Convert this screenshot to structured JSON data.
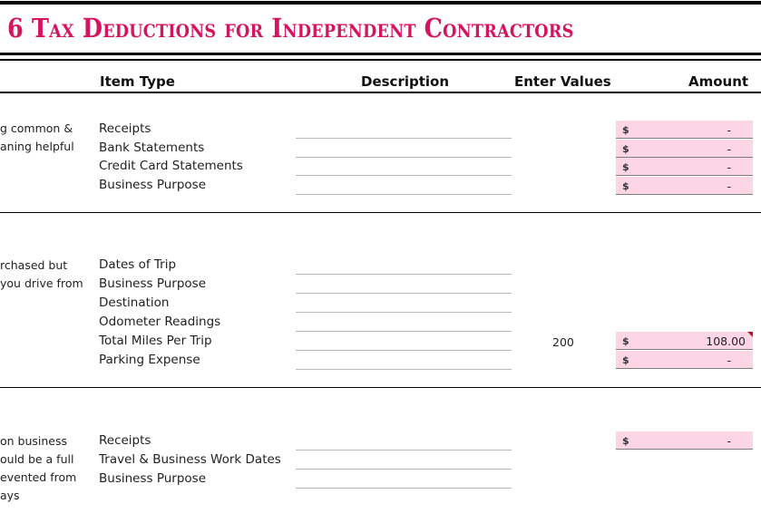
{
  "title": "6 Tax Deductions for Independent Contractors",
  "columns": {
    "item_type": "Item Type",
    "description": "Description",
    "enter_values": "Enter Values",
    "amount": "Amount"
  },
  "sections": [
    {
      "notes": [
        "g common &",
        "aning helpful"
      ],
      "items": [
        {
          "label": "Receipts",
          "description": "",
          "enter_value": "",
          "currency": "$",
          "amount": "-"
        },
        {
          "label": "Bank Statements",
          "description": "",
          "enter_value": "",
          "currency": "$",
          "amount": "-"
        },
        {
          "label": "Credit Card Statements",
          "description": "",
          "enter_value": "",
          "currency": "$",
          "amount": "-"
        },
        {
          "label": "Business Purpose",
          "description": "",
          "enter_value": "",
          "currency": "$",
          "amount": "-"
        }
      ]
    },
    {
      "notes": [
        "rchased but",
        "you drive from"
      ],
      "items": [
        {
          "label": "Dates of Trip",
          "description": "",
          "enter_value": ""
        },
        {
          "label": "Business Purpose",
          "description": "",
          "enter_value": ""
        },
        {
          "label": "Destination",
          "description": "",
          "enter_value": ""
        },
        {
          "label": "Odometer Readings",
          "description": "",
          "enter_value": ""
        },
        {
          "label": "Total Miles Per Trip",
          "description": "",
          "enter_value": "200",
          "currency": "$",
          "amount": "108.00",
          "has_comment": true
        },
        {
          "label": "Parking Expense",
          "description": "",
          "enter_value": "",
          "currency": "$",
          "amount": "-"
        }
      ]
    },
    {
      "notes": [
        "on business",
        "ould be a full",
        "evented from",
        "ays"
      ],
      "items": [
        {
          "label": "Receipts",
          "description": "",
          "enter_value": "",
          "currency": "$",
          "amount": "-"
        },
        {
          "label": "Travel & Business Work Dates",
          "description": "",
          "enter_value": ""
        },
        {
          "label": "Business Purpose",
          "description": "",
          "enter_value": ""
        }
      ]
    }
  ],
  "colors": {
    "title": "#d6135f",
    "amount_fill": "#fdd6e6",
    "comment_flag": "#c0102a"
  }
}
